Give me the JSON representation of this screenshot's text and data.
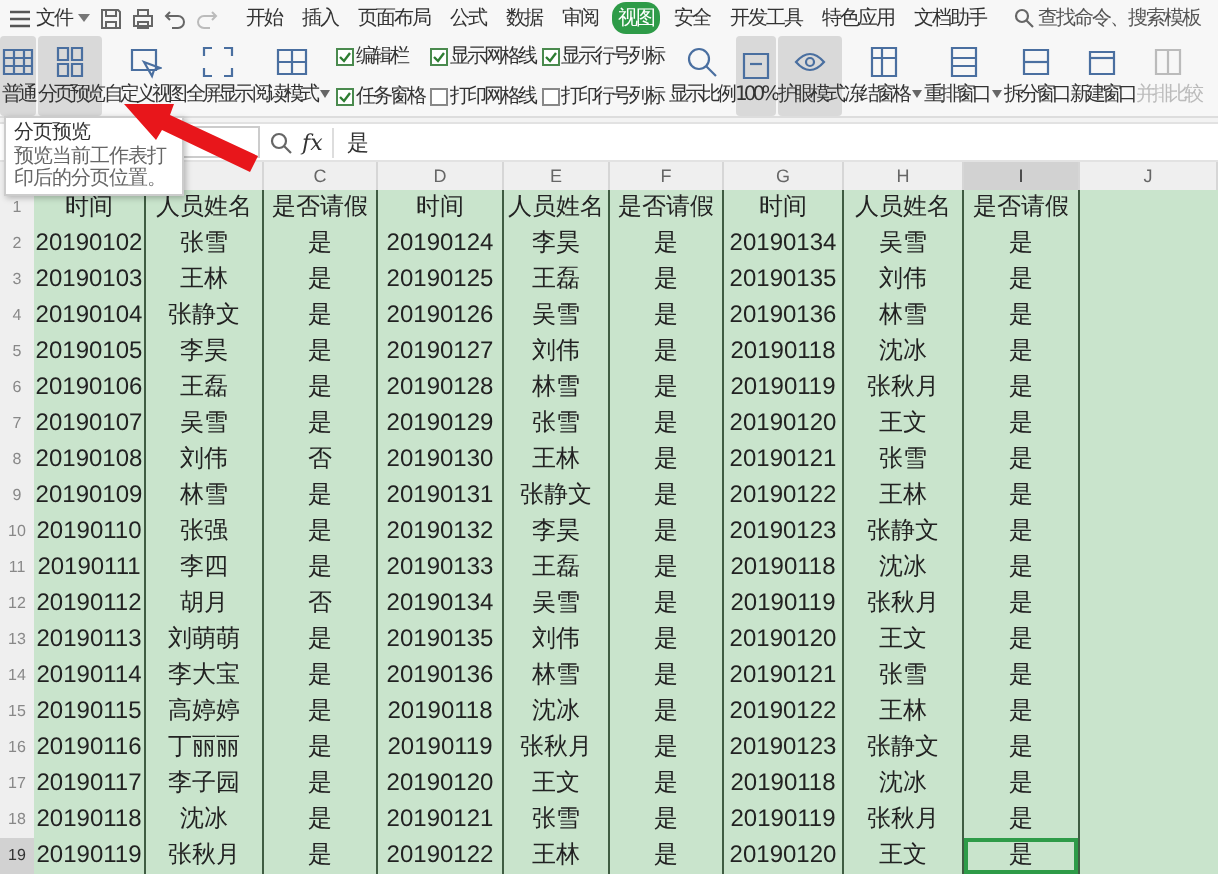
{
  "menu_bar": {
    "file_menu": "文件",
    "tabs": [
      {
        "label": "开始",
        "selected": false
      },
      {
        "label": "插入",
        "selected": false
      },
      {
        "label": "页面布局",
        "selected": false
      },
      {
        "label": "公式",
        "selected": false
      },
      {
        "label": "数据",
        "selected": false
      },
      {
        "label": "审阅",
        "selected": false
      },
      {
        "label": "视图",
        "selected": true
      },
      {
        "label": "安全",
        "selected": false
      },
      {
        "label": "开发工具",
        "selected": false
      },
      {
        "label": "特色应用",
        "selected": false
      },
      {
        "label": "文档助手",
        "selected": false
      }
    ],
    "search": {
      "label": "查找命令、搜索模板"
    }
  },
  "ribbon": {
    "left_buttons": [
      {
        "label": "普通",
        "selected": true,
        "dropdown": false,
        "disabled": false
      },
      {
        "label": "分页预览",
        "selected": true,
        "dropdown": false,
        "disabled": false
      },
      {
        "label": "自定义视图",
        "selected": false,
        "dropdown": false,
        "disabled": false
      },
      {
        "label": "全屏显示",
        "selected": false,
        "dropdown": false,
        "disabled": false
      },
      {
        "label": "阅读模式",
        "selected": false,
        "dropdown": true,
        "disabled": false
      }
    ],
    "checkboxes": [
      {
        "label": "编辑栏",
        "checked": true
      },
      {
        "label": "任务窗格",
        "checked": true
      },
      {
        "label": "显示网格线",
        "checked": true
      },
      {
        "label": "打印网格线",
        "checked": false
      },
      {
        "label": "显示行号列标",
        "checked": true
      },
      {
        "label": "打印行号列标",
        "checked": false
      }
    ],
    "right_buttons": [
      {
        "label": "显示比例",
        "selected": false,
        "dropdown": false,
        "disabled": false
      },
      {
        "label": "100%",
        "selected": true,
        "dropdown": false,
        "disabled": false
      },
      {
        "label": "护眼模式",
        "selected": true,
        "dropdown": false,
        "disabled": false
      },
      {
        "label": "冻结窗格",
        "selected": false,
        "dropdown": true,
        "disabled": false
      },
      {
        "label": "重排窗口",
        "selected": false,
        "dropdown": true,
        "disabled": false
      },
      {
        "label": "拆分窗口",
        "selected": false,
        "dropdown": false,
        "disabled": false
      },
      {
        "label": "新建窗口",
        "selected": false,
        "dropdown": false,
        "disabled": false
      },
      {
        "label": "并排比较",
        "selected": false,
        "dropdown": false,
        "disabled": true
      }
    ]
  },
  "tooltip": {
    "title": "分页预览",
    "text": "预览当前工作表打印后的分页位置。"
  },
  "formula_bar": {
    "function_label": "fx",
    "value": "是"
  },
  "sheet": {
    "columns": [
      {},
      {
        "selected": false
      },
      {
        "letter": "C",
        "selected": false
      },
      {
        "letter": "D",
        "selected": false
      },
      {
        "letter": "E",
        "selected": false
      },
      {
        "letter": "F",
        "selected": false
      },
      {
        "letter": "G",
        "selected": false
      },
      {
        "letter": "H",
        "selected": false
      },
      {
        "letter": "I",
        "selected": true
      },
      {
        "letter": "J",
        "selected": false
      }
    ],
    "rows": [
      {
        "number": "1",
        "selected": false,
        "cells": [
          "时间",
          "人员姓名",
          "是否请假",
          "时间",
          "人员姓名",
          "是否请假",
          "时间",
          "人员姓名",
          "是否请假"
        ]
      },
      {
        "number": "2",
        "selected": false,
        "cells": [
          "20190102",
          "张雪",
          "是",
          "20190124",
          "李昊",
          "是",
          "20190134",
          "吴雪",
          "是"
        ]
      },
      {
        "number": "3",
        "selected": false,
        "cells": [
          "20190103",
          "王林",
          "是",
          "20190125",
          "王磊",
          "是",
          "20190135",
          "刘伟",
          "是"
        ]
      },
      {
        "number": "4",
        "selected": false,
        "cells": [
          "20190104",
          "张静文",
          "是",
          "20190126",
          "吴雪",
          "是",
          "20190136",
          "林雪",
          "是"
        ]
      },
      {
        "number": "5",
        "selected": false,
        "cells": [
          "20190105",
          "李昊",
          "是",
          "20190127",
          "刘伟",
          "是",
          "20190118",
          "沈冰",
          "是"
        ]
      },
      {
        "number": "6",
        "selected": false,
        "cells": [
          "20190106",
          "王磊",
          "是",
          "20190128",
          "林雪",
          "是",
          "20190119",
          "张秋月",
          "是"
        ]
      },
      {
        "number": "7",
        "selected": false,
        "cells": [
          "20190107",
          "吴雪",
          "是",
          "20190129",
          "张雪",
          "是",
          "20190120",
          "王文",
          "是"
        ]
      },
      {
        "number": "8",
        "selected": false,
        "cells": [
          "20190108",
          "刘伟",
          "否",
          "20190130",
          "王林",
          "是",
          "20190121",
          "张雪",
          "是"
        ]
      },
      {
        "number": "9",
        "selected": false,
        "cells": [
          "20190109",
          "林雪",
          "是",
          "20190131",
          "张静文",
          "是",
          "20190122",
          "王林",
          "是"
        ]
      },
      {
        "number": "10",
        "selected": false,
        "cells": [
          "20190110",
          "张强",
          "是",
          "20190132",
          "李昊",
          "是",
          "20190123",
          "张静文",
          "是"
        ]
      },
      {
        "number": "11",
        "selected": false,
        "cells": [
          "20190111",
          "李四",
          "是",
          "20190133",
          "王磊",
          "是",
          "20190118",
          "沈冰",
          "是"
        ]
      },
      {
        "number": "12",
        "selected": false,
        "cells": [
          "20190112",
          "胡月",
          "否",
          "20190134",
          "吴雪",
          "是",
          "20190119",
          "张秋月",
          "是"
        ]
      },
      {
        "number": "13",
        "selected": false,
        "cells": [
          "20190113",
          "刘萌萌",
          "是",
          "20190135",
          "刘伟",
          "是",
          "20190120",
          "王文",
          "是"
        ]
      },
      {
        "number": "14",
        "selected": false,
        "cells": [
          "20190114",
          "李大宝",
          "是",
          "20190136",
          "林雪",
          "是",
          "20190121",
          "张雪",
          "是"
        ]
      },
      {
        "number": "15",
        "selected": false,
        "cells": [
          "20190115",
          "高婷婷",
          "是",
          "20190118",
          "沈冰",
          "是",
          "20190122",
          "王林",
          "是"
        ]
      },
      {
        "number": "16",
        "selected": false,
        "cells": [
          "20190116",
          "丁丽丽",
          "是",
          "20190119",
          "张秋月",
          "是",
          "20190123",
          "张静文",
          "是"
        ]
      },
      {
        "number": "17",
        "selected": false,
        "cells": [
          "20190117",
          "李子园",
          "是",
          "20190120",
          "王文",
          "是",
          "20190118",
          "沈冰",
          "是"
        ]
      },
      {
        "number": "18",
        "selected": false,
        "cells": [
          "20190118",
          "沈冰",
          "是",
          "20190121",
          "张雪",
          "是",
          "20190119",
          "张秋月",
          "是"
        ]
      },
      {
        "number": "19",
        "selected": true,
        "cells": [
          "20190119",
          "张秋月",
          "是",
          "20190122",
          "王林",
          "是",
          "20190120",
          "王文",
          "是"
        ]
      }
    ]
  }
}
